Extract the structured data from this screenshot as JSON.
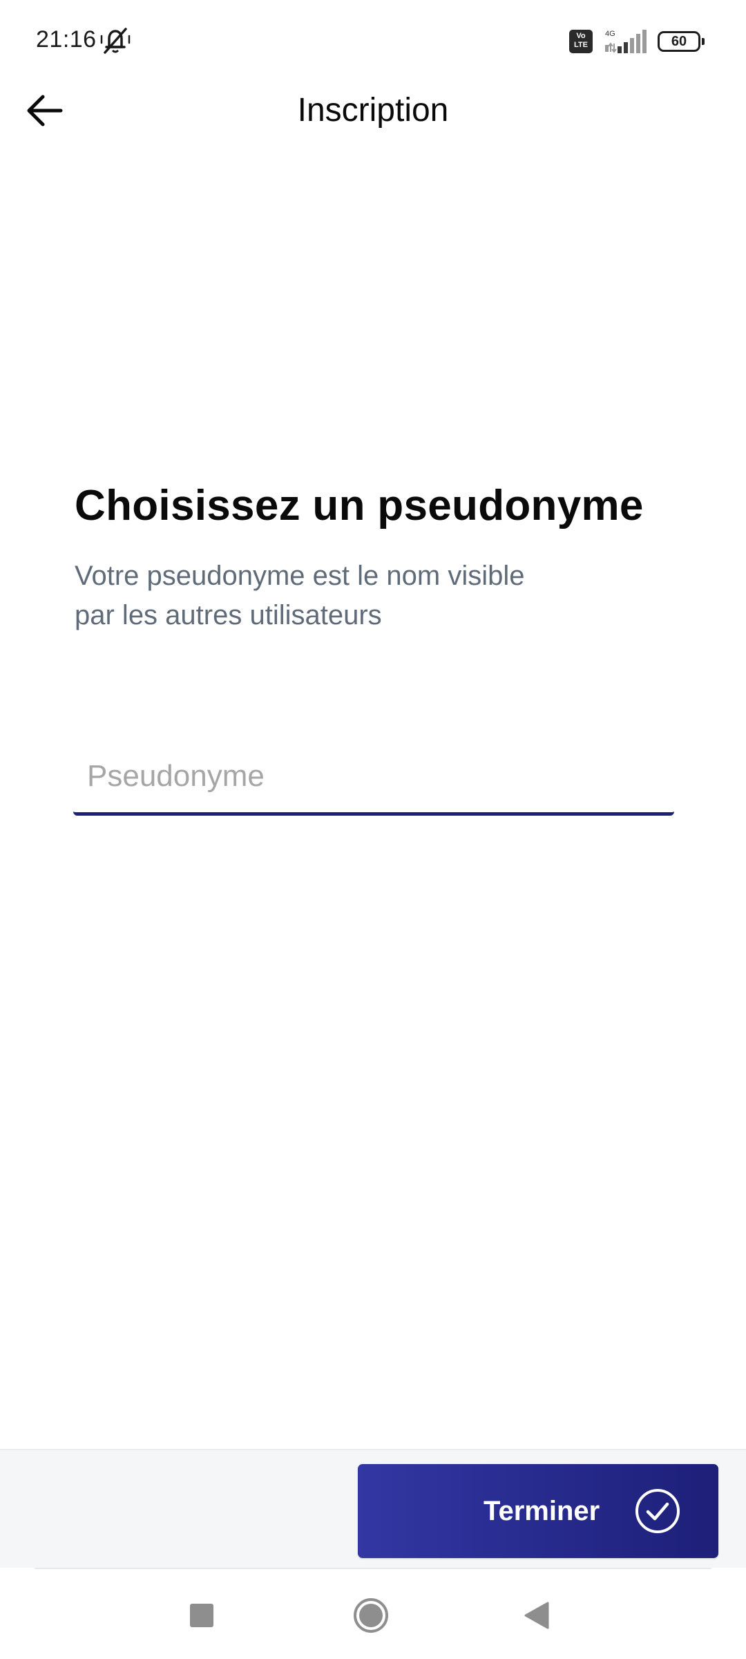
{
  "status_bar": {
    "time": "21:16",
    "network": "4G",
    "volte": "Vo\nLTE",
    "battery": "60"
  },
  "app_bar": {
    "title": "Inscription"
  },
  "main": {
    "heading": "Choisissez un pseudonyme",
    "subtitle": "Votre pseudonyme est le nom visible par les autres utilisateurs",
    "input": {
      "placeholder": "Pseudonyme",
      "value": ""
    }
  },
  "footer": {
    "finish_label": "Terminer"
  },
  "colors": {
    "accent": "#1d1f78",
    "accent_start": "#3237a3",
    "subtitle": "#5f6b78",
    "placeholder": "#a6a6a6"
  },
  "icons": {
    "back": "arrow-left-icon",
    "mute": "bell-off-icon",
    "check": "check-circle-icon",
    "nav_recent": "square-icon",
    "nav_home": "circle-icon",
    "nav_back": "triangle-back-icon"
  }
}
